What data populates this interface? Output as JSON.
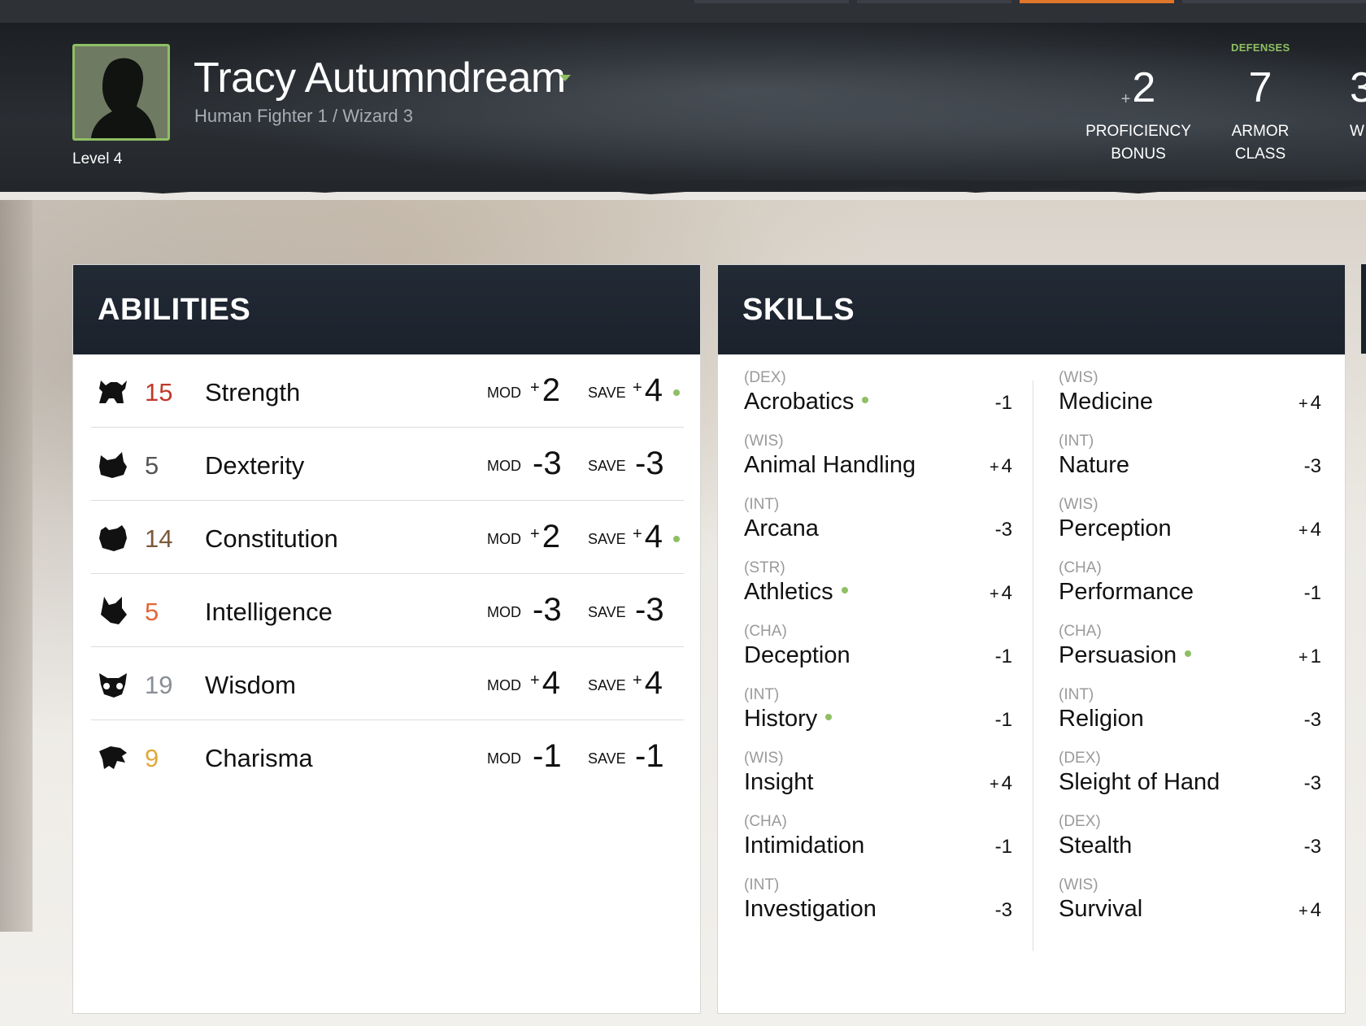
{
  "header": {
    "name": "Tracy Autumndream",
    "subtitle": "Human  Fighter 1 / Wizard 3",
    "level": "Level 4",
    "defenses_label": "DEFENSES",
    "proficiency": {
      "sign": "+",
      "value": "2",
      "label1": "PROFICIENCY",
      "label2": "BONUS"
    },
    "armor_class": {
      "value": "7",
      "label1": "ARMOR",
      "label2": "CLASS"
    },
    "cut_stat": {
      "value": "3",
      "label1": "W"
    }
  },
  "abilities": {
    "title": "ABILITIES",
    "mod_label": "MOD",
    "save_label": "SAVE",
    "rows": [
      {
        "name": "Strength",
        "score": "15",
        "score_color": "#c0392b",
        "mod_sign": "+",
        "mod": "2",
        "save_sign": "+",
        "save": "4",
        "proficient": true,
        "icon": "bull-icon"
      },
      {
        "name": "Dexterity",
        "score": "5",
        "score_color": "#555555",
        "mod_sign": "",
        "mod": "-3",
        "save_sign": "",
        "save": "-3",
        "proficient": false,
        "icon": "cat-icon"
      },
      {
        "name": "Constitution",
        "score": "14",
        "score_color": "#7a5a3a",
        "mod_sign": "+",
        "mod": "2",
        "save_sign": "+",
        "save": "4",
        "proficient": true,
        "icon": "bear-icon"
      },
      {
        "name": "Intelligence",
        "score": "5",
        "score_color": "#e0683a",
        "mod_sign": "",
        "mod": "-3",
        "save_sign": "",
        "save": "-3",
        "proficient": false,
        "icon": "fox-icon"
      },
      {
        "name": "Wisdom",
        "score": "19",
        "score_color": "#8a8f96",
        "mod_sign": "+",
        "mod": "4",
        "save_sign": "+",
        "save": "4",
        "proficient": false,
        "icon": "owl-icon"
      },
      {
        "name": "Charisma",
        "score": "9",
        "score_color": "#e0a83a",
        "mod_sign": "",
        "mod": "-1",
        "save_sign": "",
        "save": "-1",
        "proficient": false,
        "icon": "eagle-icon"
      }
    ]
  },
  "skills": {
    "title": "SKILLS",
    "left": [
      {
        "attr": "(DEX)",
        "name": "Acrobatics",
        "sign": "",
        "value": "-1",
        "proficient": true
      },
      {
        "attr": "(WIS)",
        "name": "Animal Handling",
        "sign": "+",
        "value": "4",
        "proficient": false
      },
      {
        "attr": "(INT)",
        "name": "Arcana",
        "sign": "",
        "value": "-3",
        "proficient": false
      },
      {
        "attr": "(STR)",
        "name": "Athletics",
        "sign": "+",
        "value": "4",
        "proficient": true
      },
      {
        "attr": "(CHA)",
        "name": "Deception",
        "sign": "",
        "value": "-1",
        "proficient": false
      },
      {
        "attr": "(INT)",
        "name": "History",
        "sign": "",
        "value": "-1",
        "proficient": true
      },
      {
        "attr": "(WIS)",
        "name": "Insight",
        "sign": "+",
        "value": "4",
        "proficient": false
      },
      {
        "attr": "(CHA)",
        "name": "Intimidation",
        "sign": "",
        "value": "-1",
        "proficient": false
      },
      {
        "attr": "(INT)",
        "name": "Investigation",
        "sign": "",
        "value": "-3",
        "proficient": false
      }
    ],
    "right": [
      {
        "attr": "(WIS)",
        "name": "Medicine",
        "sign": "+",
        "value": "4",
        "proficient": false
      },
      {
        "attr": "(INT)",
        "name": "Nature",
        "sign": "",
        "value": "-3",
        "proficient": false
      },
      {
        "attr": "(WIS)",
        "name": "Perception",
        "sign": "+",
        "value": "4",
        "proficient": false
      },
      {
        "attr": "(CHA)",
        "name": "Performance",
        "sign": "",
        "value": "-1",
        "proficient": false
      },
      {
        "attr": "(CHA)",
        "name": "Persuasion",
        "sign": "+",
        "value": "1",
        "proficient": true
      },
      {
        "attr": "(INT)",
        "name": "Religion",
        "sign": "",
        "value": "-3",
        "proficient": false
      },
      {
        "attr": "(DEX)",
        "name": "Sleight of Hand",
        "sign": "",
        "value": "-3",
        "proficient": false
      },
      {
        "attr": "(DEX)",
        "name": "Stealth",
        "sign": "",
        "value": "-3",
        "proficient": false
      },
      {
        "attr": "(WIS)",
        "name": "Survival",
        "sign": "+",
        "value": "4",
        "proficient": false
      }
    ]
  },
  "colors": {
    "accent": "#8fbf63",
    "tab_active": "#e0762a",
    "panel_head": "#1b222c"
  }
}
